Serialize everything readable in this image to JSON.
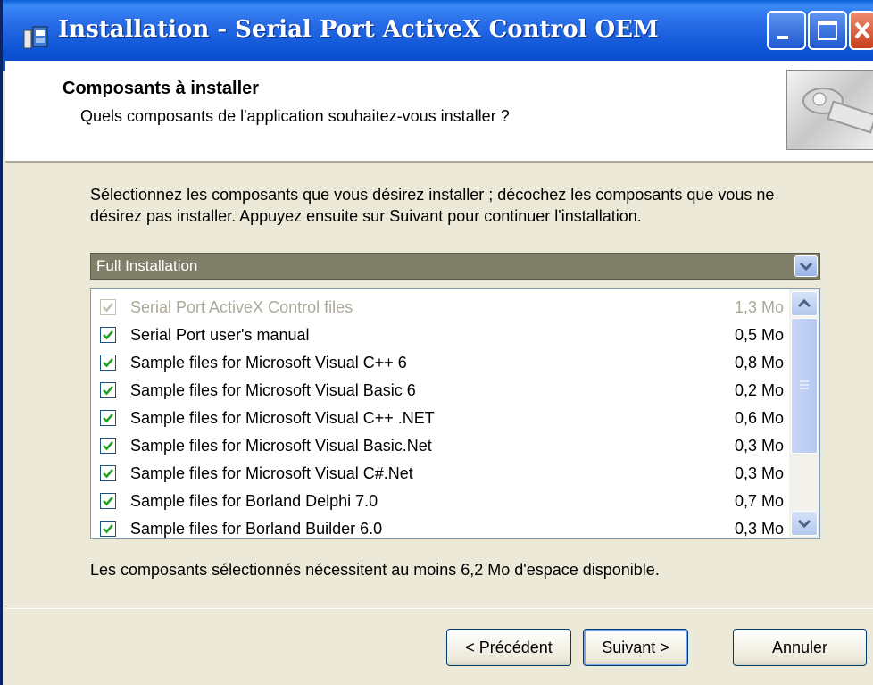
{
  "window": {
    "title": "Installation - Serial Port ActiveX Control OEM"
  },
  "header": {
    "title": "Composants à installer",
    "subtitle": "Quels composants de l'application souhaitez-vous installer ?"
  },
  "main": {
    "instructions": "Sélectionnez les composants que vous désirez installer ; décochez les composants que vous ne désirez pas installer. Appuyez ensuite sur Suivant pour continuer l'installation.",
    "install_type": "Full Installation",
    "components": [
      {
        "label": "Serial Port ActiveX Control files",
        "size": "1,3 Mo",
        "checked": true,
        "disabled": true
      },
      {
        "label": "Serial Port user's manual",
        "size": "0,5 Mo",
        "checked": true,
        "disabled": false
      },
      {
        "label": "Sample files for Microsoft Visual C++ 6",
        "size": "0,8 Mo",
        "checked": true,
        "disabled": false
      },
      {
        "label": "Sample files for Microsoft Visual Basic 6",
        "size": "0,2 Mo",
        "checked": true,
        "disabled": false
      },
      {
        "label": "Sample files for Microsoft Visual C++ .NET",
        "size": "0,6 Mo",
        "checked": true,
        "disabled": false
      },
      {
        "label": "Sample files for Microsoft Visual Basic.Net",
        "size": "0,3 Mo",
        "checked": true,
        "disabled": false
      },
      {
        "label": "Sample files for Microsoft Visual C#.Net",
        "size": "0,3 Mo",
        "checked": true,
        "disabled": false
      },
      {
        "label": "Sample files for Borland Delphi 7.0",
        "size": "0,7 Mo",
        "checked": true,
        "disabled": false
      },
      {
        "label": "Sample files for Borland Builder 6.0",
        "size": "0,3 Mo",
        "checked": true,
        "disabled": false
      }
    ],
    "space_required": "Les composants sélectionnés nécessitent au moins 6,2 Mo d'espace disponible."
  },
  "buttons": {
    "back": "< Précédent",
    "next": "Suivant >",
    "cancel": "Annuler"
  },
  "colors": {
    "titlebar": "#0a55d6",
    "accent": "#316ac5",
    "check": "#21a121"
  }
}
